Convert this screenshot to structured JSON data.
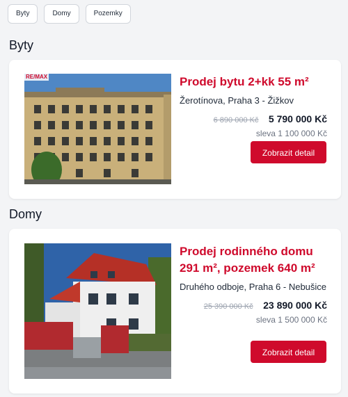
{
  "filters": [
    "Byty",
    "Domy",
    "Pozemky"
  ],
  "sections": [
    {
      "heading": "Byty",
      "listing": {
        "title": "Prodej bytu 2+kk 55 m²",
        "address": "Žerotínova, Praha 3 - Žižkov",
        "old_price": "6 890 000 Kč",
        "price": "5 790 000 Kč",
        "discount": "sleva 1 100 000 Kč",
        "button": "Zobrazit detail",
        "logo": "RE/MAX"
      }
    },
    {
      "heading": "Domy",
      "listing": {
        "title": "Prodej rodinného domu 291 m², pozemek 640 m²",
        "address": "Druhého odboje, Praha 6 - Nebušice",
        "old_price": "25 390 000 Kč",
        "price": "23 890 000 Kč",
        "discount": "sleva 1 500 000 Kč",
        "button": "Zobrazit detail"
      }
    }
  ],
  "colors": {
    "accent": "#cf0a2c",
    "background": "#f3f4f6",
    "card": "#ffffff"
  }
}
